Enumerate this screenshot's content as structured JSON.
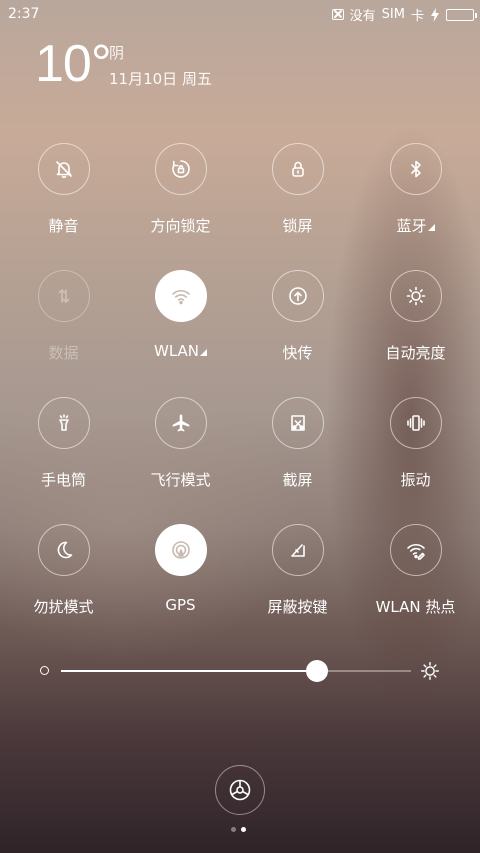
{
  "status_bar": {
    "time": "2:37",
    "no_sim_label": "没有",
    "sim_label": "SIM",
    "card_label": "卡",
    "battery_color": "#2ee07e"
  },
  "weather": {
    "temperature": "10°",
    "condition": "阴",
    "date": "11月10日 周五"
  },
  "toggles": [
    {
      "label": "静音",
      "icon": "bell-mute-icon",
      "state": "off"
    },
    {
      "label": "方向锁定",
      "icon": "rotation-lock-icon",
      "state": "off"
    },
    {
      "label": "锁屏",
      "icon": "lock-icon",
      "state": "off"
    },
    {
      "label": "蓝牙",
      "icon": "bluetooth-icon",
      "state": "off",
      "has_menu": true
    },
    {
      "label": "数据",
      "icon": "mobile-data-icon",
      "state": "disabled"
    },
    {
      "label": "WLAN",
      "icon": "wifi-icon",
      "state": "on",
      "has_menu": true
    },
    {
      "label": "快传",
      "icon": "quick-transfer-icon",
      "state": "off"
    },
    {
      "label": "自动亮度",
      "icon": "auto-brightness-icon",
      "state": "off"
    },
    {
      "label": "手电筒",
      "icon": "flashlight-icon",
      "state": "off"
    },
    {
      "label": "飞行模式",
      "icon": "airplane-icon",
      "state": "off"
    },
    {
      "label": "截屏",
      "icon": "screenshot-icon",
      "state": "off"
    },
    {
      "label": "振动",
      "icon": "vibrate-icon",
      "state": "off"
    },
    {
      "label": "勿扰模式",
      "icon": "moon-icon",
      "state": "off"
    },
    {
      "label": "GPS",
      "icon": "gps-icon",
      "state": "on"
    },
    {
      "label": "屏蔽按键",
      "icon": "block-keys-icon",
      "state": "off"
    },
    {
      "label": "WLAN 热点",
      "icon": "hotspot-icon",
      "state": "off"
    }
  ],
  "brightness": {
    "level_fraction": 0.73
  },
  "pager": {
    "pages": 2,
    "current": 2
  }
}
